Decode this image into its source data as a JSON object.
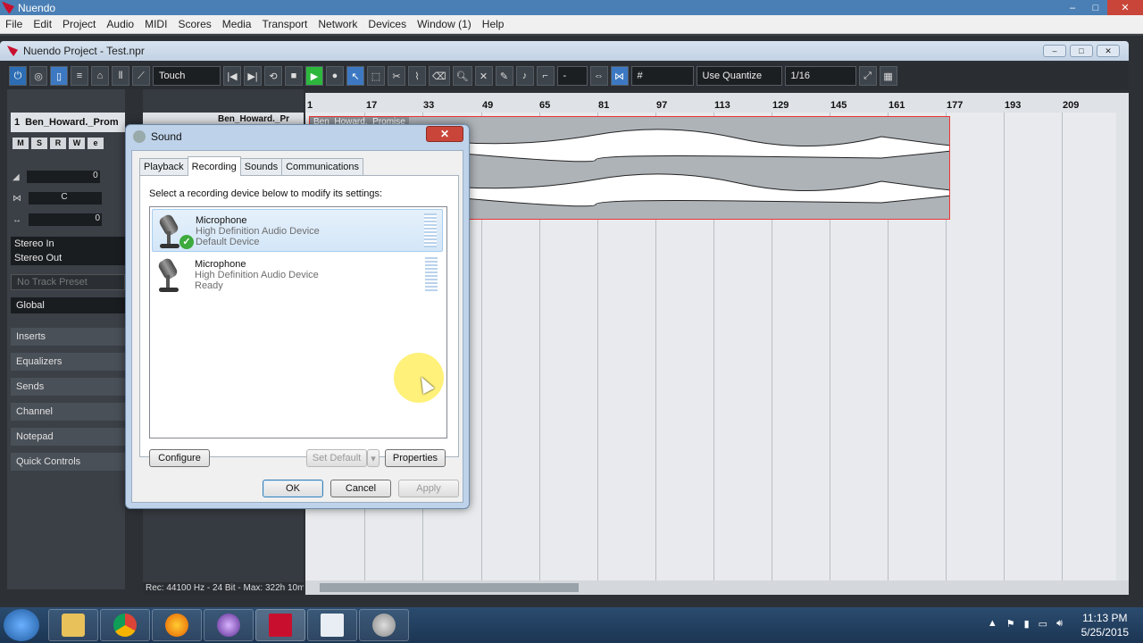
{
  "app": {
    "title": "Nuendo"
  },
  "menu": [
    "File",
    "Edit",
    "Project",
    "Audio",
    "MIDI",
    "Scores",
    "Media",
    "Transport",
    "Network",
    "Devices",
    "Window (1)",
    "Help"
  ],
  "project": {
    "title": "Nuendo Project - Test.npr",
    "automation_mode": "Touch",
    "quantize_label": "Use Quantize",
    "quantize_value": "1/16",
    "snap_value": "-"
  },
  "inspector": {
    "track_number": "1",
    "track_name": "Ben_Howard._Prom",
    "buttons": [
      "M",
      "S",
      "R",
      "W",
      "e"
    ],
    "volume": "0",
    "pan": "C",
    "delay": "0",
    "input": "Stereo In",
    "output": "Stereo Out",
    "preset": "No Track Preset",
    "global": "Global",
    "sections": [
      "Inserts",
      "Equalizers",
      "Sends",
      "Channel",
      "Notepad",
      "Quick Controls"
    ]
  },
  "track": {
    "name": "Ben_Howard._Pr",
    "event_name": "Ben_Howard._Promise"
  },
  "ruler": [
    "1",
    "17",
    "33",
    "49",
    "65",
    "81",
    "97",
    "113",
    "129",
    "145",
    "161",
    "177",
    "193",
    "209"
  ],
  "status": "Rec: 44100 Hz - 24 Bit - Max: 322h 10m",
  "sound_dialog": {
    "title": "Sound",
    "tabs": [
      "Playback",
      "Recording",
      "Sounds",
      "Communications"
    ],
    "active_tab": "Recording",
    "hint": "Select a recording device below to modify its settings:",
    "devices": [
      {
        "name": "Microphone",
        "driver": "High Definition Audio Device",
        "state": "Default Device"
      },
      {
        "name": "Microphone",
        "driver": "High Definition Audio Device",
        "state": "Ready"
      }
    ],
    "configure": "Configure",
    "set_default": "Set Default",
    "properties": "Properties",
    "ok": "OK",
    "cancel": "Cancel",
    "apply": "Apply"
  },
  "taskbar": {
    "time": "11:13 PM",
    "date": "5/25/2015"
  }
}
